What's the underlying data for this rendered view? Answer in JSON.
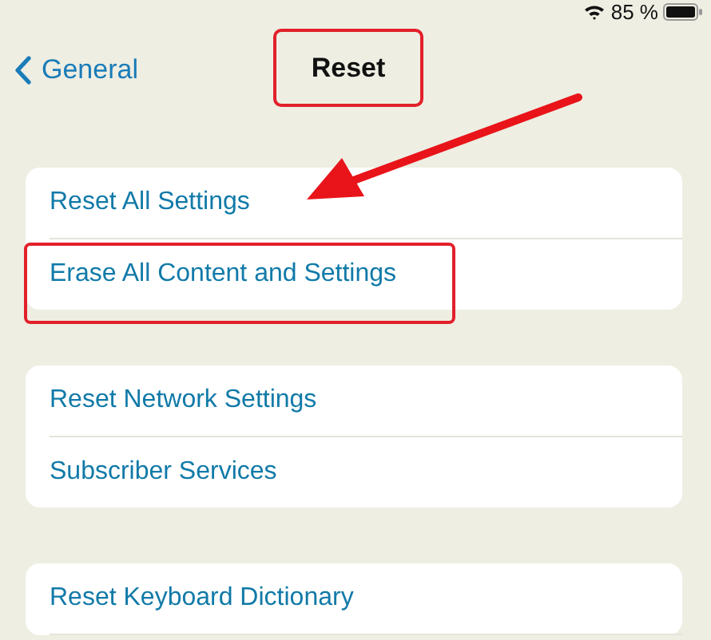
{
  "status_bar": {
    "battery": "85 %"
  },
  "nav": {
    "back": "General",
    "title": "Reset",
    "title_highlighted": true
  },
  "groups": [
    {
      "rows": [
        {
          "label": "Reset All Settings",
          "highlighted": false,
          "pointed": true
        },
        {
          "label": "Erase All Content and Settings",
          "highlighted": true,
          "pointed": false
        }
      ]
    },
    {
      "rows": [
        {
          "label": "Reset Network Settings",
          "highlighted": false,
          "pointed": false
        },
        {
          "label": "Subscriber Services",
          "highlighted": false,
          "pointed": false
        }
      ]
    },
    {
      "rows": [
        {
          "label": "Reset Keyboard Dictionary",
          "highlighted": false,
          "pointed": false
        }
      ],
      "more_below": true
    }
  ]
}
